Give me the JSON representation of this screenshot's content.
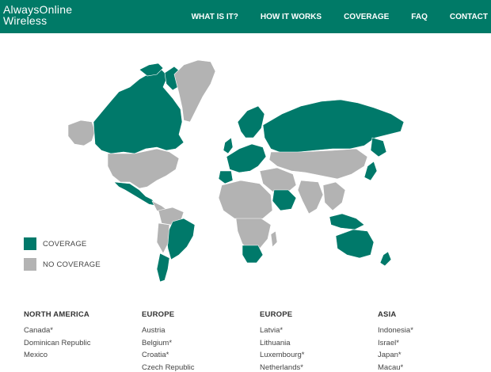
{
  "header": {
    "logo_line1": "AlwaysOnline",
    "logo_line2": "Wireless",
    "nav": [
      "WHAT IS IT?",
      "HOW IT WORKS",
      "COVERAGE",
      "FAQ",
      "CONTACT"
    ]
  },
  "colors": {
    "brand": "#007a67",
    "coverage": "#00796a",
    "no_coverage": "#b3b3b3"
  },
  "legend": {
    "coverage_label": "COVERAGE",
    "no_coverage_label": "NO COVERAGE"
  },
  "regions": [
    {
      "title": "NORTH AMERICA",
      "countries": [
        "Canada*",
        "Dominican Republic",
        "Mexico"
      ]
    },
    {
      "title": "EUROPE",
      "countries": [
        "Austria",
        "Belgium*",
        "Croatia*",
        "Czech Republic"
      ]
    },
    {
      "title": "EUROPE",
      "countries": [
        "Latvia*",
        "Lithuania",
        "Luxembourg*",
        "Netherlands*"
      ]
    },
    {
      "title": "ASIA",
      "countries": [
        "Indonesia*",
        "Israel*",
        "Japan*",
        "Macau*"
      ]
    }
  ]
}
